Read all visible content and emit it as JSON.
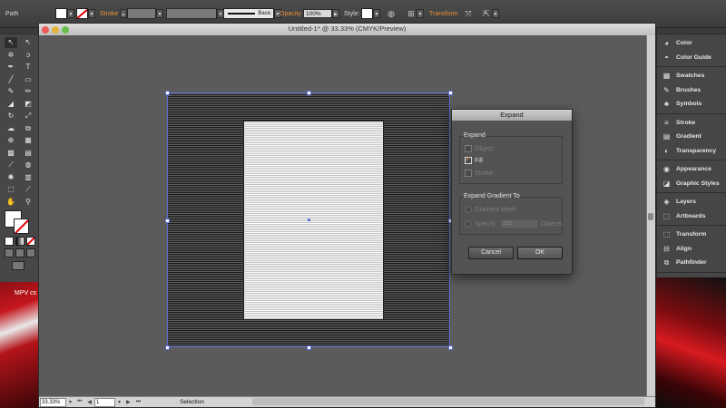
{
  "control_bar": {
    "selection_label": "Path",
    "stroke_label": "Stroke",
    "brush_name": "Basic",
    "opacity_label": "Opacity",
    "opacity_value": "100%",
    "style_label": "Style:",
    "transform_label": "Transform",
    "accent_color": "#e7923b"
  },
  "tools": [
    {
      "icon": "selection-tool-icon",
      "glyph": "↖"
    },
    {
      "icon": "direct-selection-tool-icon",
      "glyph": "↖"
    },
    {
      "icon": "magic-wand-tool-icon",
      "glyph": "✲"
    },
    {
      "icon": "lasso-tool-icon",
      "glyph": "ↄ"
    },
    {
      "icon": "pen-tool-icon",
      "glyph": "✒"
    },
    {
      "icon": "type-tool-icon",
      "glyph": "T"
    },
    {
      "icon": "line-tool-icon",
      "glyph": "╱"
    },
    {
      "icon": "rectangle-tool-icon",
      "glyph": "▭"
    },
    {
      "icon": "paintbrush-tool-icon",
      "glyph": "✎"
    },
    {
      "icon": "pencil-tool-icon",
      "glyph": "✏"
    },
    {
      "icon": "blob-brush-tool-icon",
      "glyph": "◢"
    },
    {
      "icon": "eraser-tool-icon",
      "glyph": "◩"
    },
    {
      "icon": "rotate-tool-icon",
      "glyph": "↻"
    },
    {
      "icon": "scale-tool-icon",
      "glyph": "⤢"
    },
    {
      "icon": "warp-tool-icon",
      "glyph": "☁"
    },
    {
      "icon": "free-transform-tool-icon",
      "glyph": "⧉"
    },
    {
      "icon": "shape-builder-tool-icon",
      "glyph": "⊕"
    },
    {
      "icon": "perspective-grid-tool-icon",
      "glyph": "▦"
    },
    {
      "icon": "mesh-tool-icon",
      "glyph": "▩"
    },
    {
      "icon": "gradient-tool-icon",
      "glyph": "▤"
    },
    {
      "icon": "eyedropper-tool-icon",
      "glyph": "⟋"
    },
    {
      "icon": "blend-tool-icon",
      "glyph": "◍"
    },
    {
      "icon": "symbol-sprayer-tool-icon",
      "glyph": "✺"
    },
    {
      "icon": "column-graph-tool-icon",
      "glyph": "▥"
    },
    {
      "icon": "artboard-tool-icon",
      "glyph": "⬚"
    },
    {
      "icon": "slice-tool-icon",
      "glyph": "⟋"
    },
    {
      "icon": "hand-tool-icon",
      "glyph": "✋"
    },
    {
      "icon": "zoom-tool-icon",
      "glyph": "⚲"
    }
  ],
  "document": {
    "title": "Untitled-1* @ 33.33% (CMYK/Preview)",
    "zoom": "33.33%",
    "page": "1",
    "status": "Selection"
  },
  "dialog": {
    "title": "Expand",
    "expand_group": "Expand",
    "object_label": "Object",
    "fill_label": "Fill",
    "stroke_label": "Stroke",
    "gradient_group": "Expand Gradient To",
    "gradient_mesh_label": "Gradient Mesh",
    "specify_label": "Specify:",
    "specify_value": "255",
    "objects_label": "Objects",
    "cancel_label": "Cancel",
    "ok_label": "OK"
  },
  "panels": [
    [
      {
        "label": "Color",
        "icon": "color-panel-icon",
        "glyph": "◕"
      },
      {
        "label": "Color Guide",
        "icon": "color-guide-icon",
        "glyph": "◓"
      }
    ],
    [
      {
        "label": "Swatches",
        "icon": "swatches-icon",
        "glyph": "▦"
      },
      {
        "label": "Brushes",
        "icon": "brushes-icon",
        "glyph": "✎"
      },
      {
        "label": "Symbols",
        "icon": "symbols-icon",
        "glyph": "♣"
      }
    ],
    [
      {
        "label": "Stroke",
        "icon": "stroke-panel-icon",
        "glyph": "≡"
      },
      {
        "label": "Gradient",
        "icon": "gradient-panel-icon",
        "glyph": "▤"
      },
      {
        "label": "Transparency",
        "icon": "transparency-icon",
        "glyph": "◐"
      }
    ],
    [
      {
        "label": "Appearance",
        "icon": "appearance-icon",
        "glyph": "◉"
      },
      {
        "label": "Graphic Styles",
        "icon": "graphic-styles-icon",
        "glyph": "◪"
      }
    ],
    [
      {
        "label": "Layers",
        "icon": "layers-icon",
        "glyph": "◈"
      },
      {
        "label": "Artboards",
        "icon": "artboards-icon",
        "glyph": "⬚"
      }
    ],
    [
      {
        "label": "Transform",
        "icon": "transform-panel-icon",
        "glyph": "⬚"
      },
      {
        "label": "Align",
        "icon": "align-icon",
        "glyph": "⊟"
      },
      {
        "label": "Pathfinder",
        "icon": "pathfinder-icon",
        "glyph": "⧉"
      }
    ]
  ],
  "desktop": {
    "window_label": "MPV cs"
  }
}
